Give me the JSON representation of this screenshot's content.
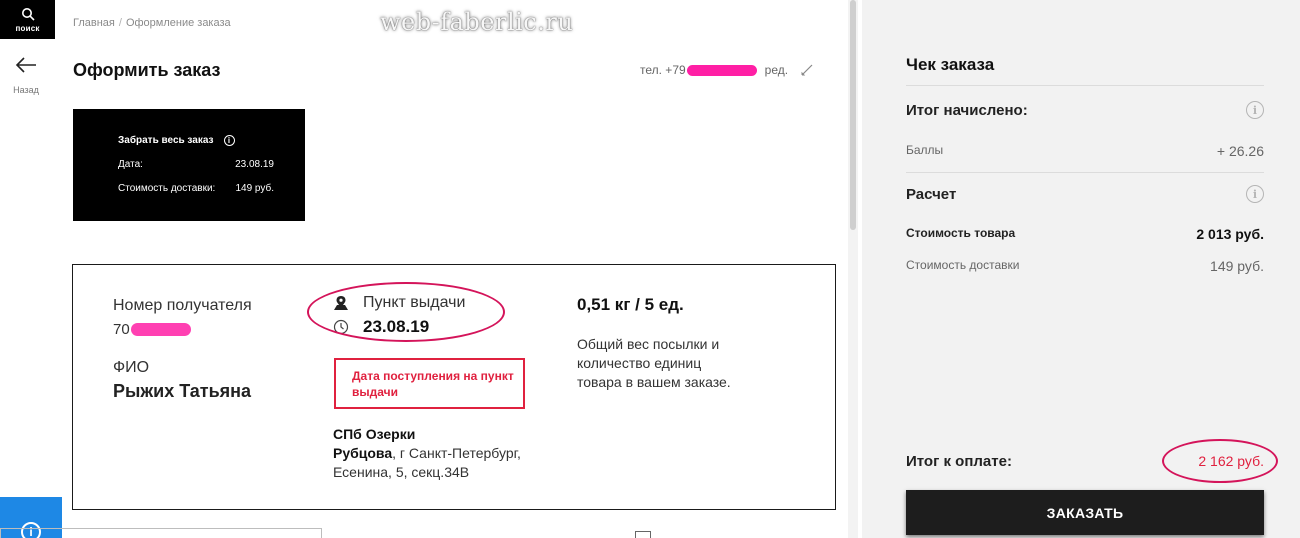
{
  "nav": {
    "search_label": "поиск",
    "back_label": "Назад"
  },
  "breadcrumb": {
    "home": "Главная",
    "separator": "/",
    "current": "Оформление заказа"
  },
  "watermark": "web-faberlic.ru",
  "page": {
    "title": "Оформить заказ",
    "phone_prefix": "тел. +79",
    "edit_label": "ред."
  },
  "pickup_card": {
    "title": "Забрать весь заказ",
    "date_label": "Дата:",
    "date_value": "23.08.19",
    "delivery_cost_label": "Стоимость доставки:",
    "delivery_cost_value": "149 руб."
  },
  "delivery": {
    "recipient_label": "Номер получателя",
    "recipient_prefix": "70",
    "fio_label": "ФИО",
    "fio_value": "Рыжих Татьяна",
    "pickup_point_label": "Пункт выдачи",
    "pickup_date": "23.08.19",
    "note": "Дата поступления на пункт выдачи",
    "point_name": "СПб Озерки",
    "point_street": "Рубцова",
    "point_address": ", г Санкт-Петербург, Есенина, 5, секц.34В",
    "weight": "0,51 кг / 5  ед.",
    "weight_desc": "Общий вес посылки и количество единиц товара в вашем заказе."
  },
  "receipt": {
    "title": "Чек заказа",
    "accrued_title": "Итог начислено:",
    "points_label": "Баллы",
    "points_value": "+ 26.26",
    "calc_title": "Расчет",
    "goods_label": "Стоимость товара",
    "goods_value": "2 013 руб.",
    "shipping_label": "Стоимость доставки",
    "shipping_value": "149 руб.",
    "total_label": "Итог к оплате:",
    "total_value": "2 162 руб.",
    "order_button": "ЗАКАЗАТЬ"
  },
  "colors": {
    "accent_red": "#e0213f",
    "annotation": "#d4145a",
    "redaction": "#ff1fa5",
    "button": "#1d1d1d",
    "panel_bg": "#f2f2f2"
  }
}
